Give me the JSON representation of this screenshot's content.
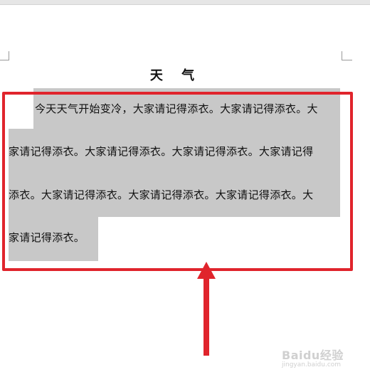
{
  "document": {
    "title": "天 气",
    "lines": [
      "今天天气开始变冷，大家请记得添衣。大家请记得添衣。大",
      "家请记得添衣。大家请记得添衣。大家请记得添衣。大家请记得",
      "添衣。大家请记得添衣。大家请记得添衣。大家请记得添衣。大",
      "家请记得添衣。"
    ]
  },
  "annotation": {
    "highlight_color": "#e0242c"
  },
  "watermark": {
    "text": "Baidu经验",
    "subtext": "jingyan.baidu.com"
  }
}
